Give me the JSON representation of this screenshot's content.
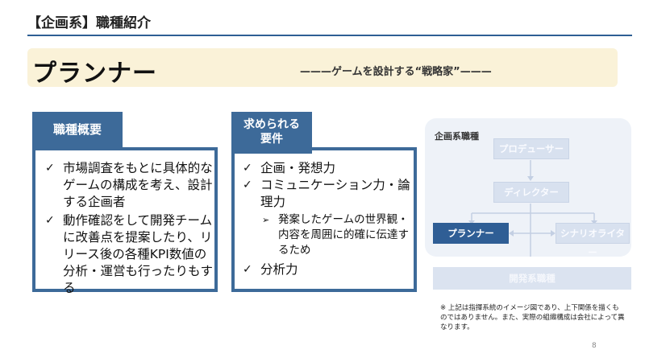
{
  "header": {
    "title": "【企画系】職種紹介"
  },
  "banner": {
    "title": "プランナー",
    "subtitle": "———ゲームを設計する“戦略家”———"
  },
  "overview": {
    "tab": "職種概要",
    "items": [
      "市場調査をもとに具体的なゲームの構成を考え、設計する企画者",
      "動作確認をして開発チームに改善点を提案したり、リリース後の各種KPI数値の分析・運営も行ったりもする"
    ]
  },
  "requirements": {
    "tab_line1": "求められる",
    "tab_line2": "要件",
    "items": [
      {
        "text": "企画・発想力"
      },
      {
        "text": "コミュニケーション力・論理力",
        "sub": "発案したゲームの世界観・内容を周囲に的確に伝達するため"
      },
      {
        "text": "分析力"
      }
    ]
  },
  "org": {
    "label": "企画系職種",
    "producer": "プロデューサー",
    "director": "ディレクター",
    "planner": "プランナー",
    "scenario_writer": "シナリオライター",
    "dev": "開発系職種"
  },
  "note": "※ 上記は指揮系統のイメージ図であり、上下関係を描くものではありません。また、実際の組織構成は会社によって異なります。",
  "page_number": "8",
  "colors": {
    "accent": "#3d6a99",
    "banner_bg": "#faf2d8",
    "org_bg": "#eef2f8",
    "node_dark": "#2f5e95"
  }
}
